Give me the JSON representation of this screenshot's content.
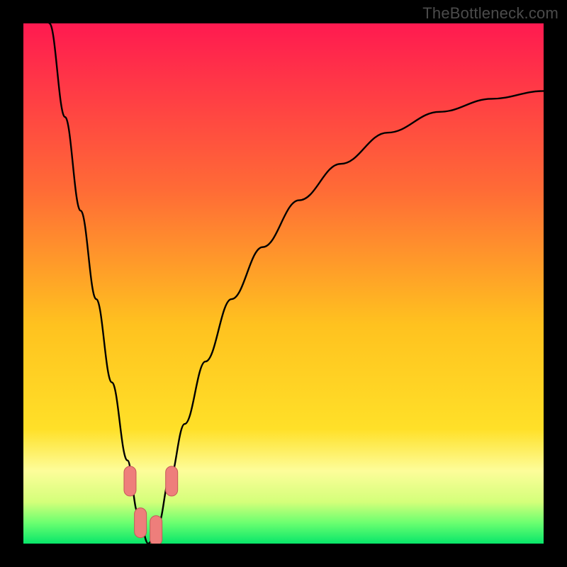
{
  "watermark": "TheBottleneck.com",
  "colors": {
    "frame_black": "#000000",
    "gradient_top": "#ff1a50",
    "gradient_mid_orange": "#ff8a2a",
    "gradient_yellow": "#ffe028",
    "gradient_pale_yellow": "#fdfd9a",
    "gradient_green": "#08e66a",
    "curve_stroke": "#000000",
    "marker_fill": "#ee7e7b",
    "marker_stroke": "#c55958"
  },
  "chart_data": {
    "type": "line",
    "title": "",
    "xlabel": "",
    "ylabel": "",
    "xlim": [
      0,
      100
    ],
    "ylim": [
      0,
      100
    ],
    "x_optimum": 24,
    "series": [
      {
        "name": "bottleneck-curve",
        "x": [
          5,
          8,
          11,
          14,
          17,
          20,
          22,
          24,
          26,
          28,
          31,
          35,
          40,
          46,
          53,
          61,
          70,
          80,
          90,
          100
        ],
        "y": [
          100,
          82,
          64,
          47,
          31,
          16,
          6,
          0,
          4,
          12,
          23,
          35,
          47,
          57,
          66,
          73,
          79,
          83,
          85.5,
          87
        ]
      }
    ],
    "markers": {
      "name": "highlight-segments",
      "points": [
        {
          "x": 20.5,
          "y": 12
        },
        {
          "x": 22.5,
          "y": 4
        },
        {
          "x": 25.5,
          "y": 2.5
        },
        {
          "x": 28.5,
          "y": 12
        }
      ]
    }
  }
}
